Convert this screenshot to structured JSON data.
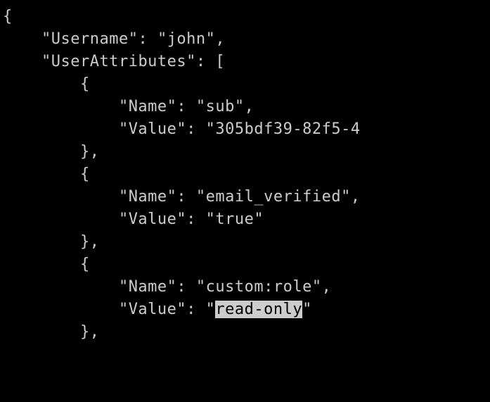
{
  "code": {
    "username_key": "Username",
    "username_val": "john",
    "userattrs_key": "UserAttributes",
    "attr0_name_key": "Name",
    "attr0_name_val": "sub",
    "attr0_value_key": "Value",
    "attr0_value_val": "305bdf39-82f5-4",
    "attr1_name_key": "Name",
    "attr1_name_val": "email_verified",
    "attr1_value_key": "Value",
    "attr1_value_val": "true",
    "attr2_name_key": "Name",
    "attr2_name_val": "custom:role",
    "attr2_value_key": "Value",
    "attr2_value_val": "read-only"
  }
}
